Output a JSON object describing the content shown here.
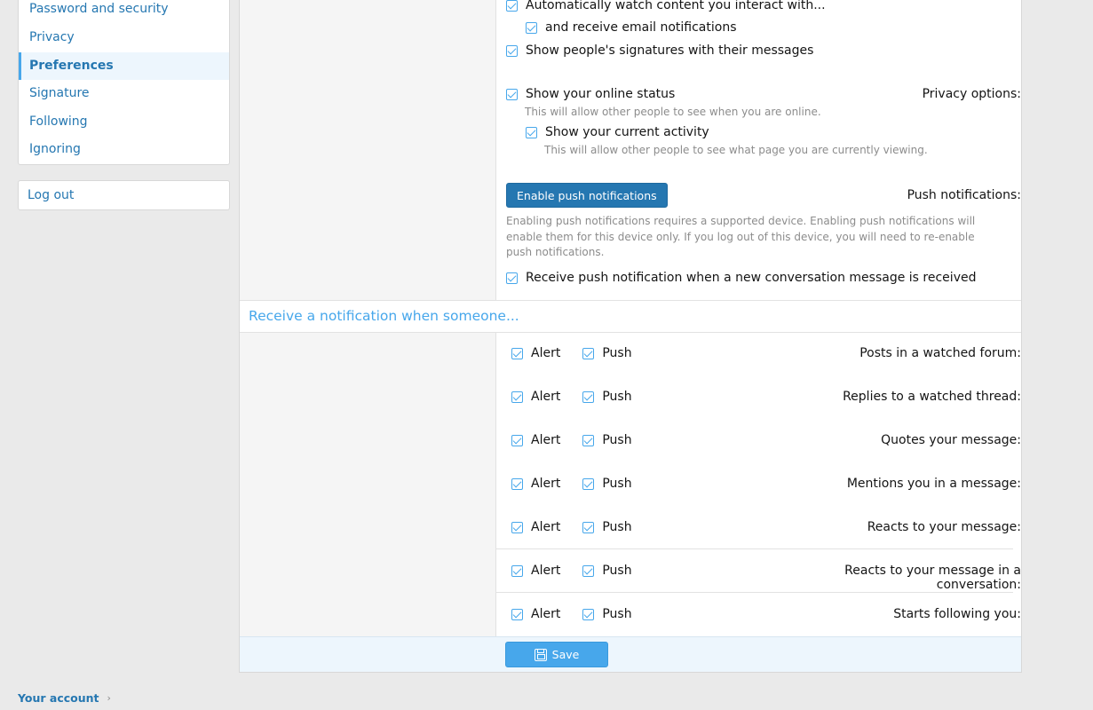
{
  "sidebar": {
    "items": [
      {
        "label": "Password and security"
      },
      {
        "label": "Privacy"
      },
      {
        "label": "Preferences"
      },
      {
        "label": "Signature"
      },
      {
        "label": "Following"
      },
      {
        "label": "Ignoring"
      }
    ],
    "logout_label": "Log out"
  },
  "breadcrumb": {
    "label": "Your account",
    "chevron": "›"
  },
  "content_options": {
    "auto_watch": "Automatically watch content you interact with...",
    "email_notifications": "and receive email notifications",
    "signatures": "Show people's signatures with their messages"
  },
  "privacy": {
    "label": "Privacy options:",
    "online_status": "Show your online status",
    "online_status_hint": "This will allow other people to see when you are online.",
    "current_activity": "Show your current activity",
    "current_activity_hint": "This will allow other people to see what page you are currently viewing."
  },
  "push": {
    "label": "Push notifications:",
    "button": "Enable push notifications",
    "hint": "Enabling push notifications requires a supported device. Enabling push notifications will enable them for this device only. If you log out of this device, you will need to re-enable push notifications.",
    "conversation": "Receive push notification when a new conversation message is received"
  },
  "notifications": {
    "heading": "Receive a notification when someone...",
    "alert_label": "Alert",
    "push_label": "Push",
    "rows": [
      {
        "label": "Posts in a watched forum:"
      },
      {
        "label": "Replies to a watched thread:"
      },
      {
        "label": "Quotes your message:"
      },
      {
        "label": "Mentions you in a message:"
      },
      {
        "label": "Reacts to your message:"
      },
      {
        "label": "Reacts to your message in a conversation:"
      },
      {
        "label": "Starts following you:"
      }
    ]
  },
  "footer": {
    "save_label": "Save"
  },
  "colors": {
    "accent": "#47a7eb",
    "link": "#2577b1",
    "button_dark": "#2577b1"
  }
}
